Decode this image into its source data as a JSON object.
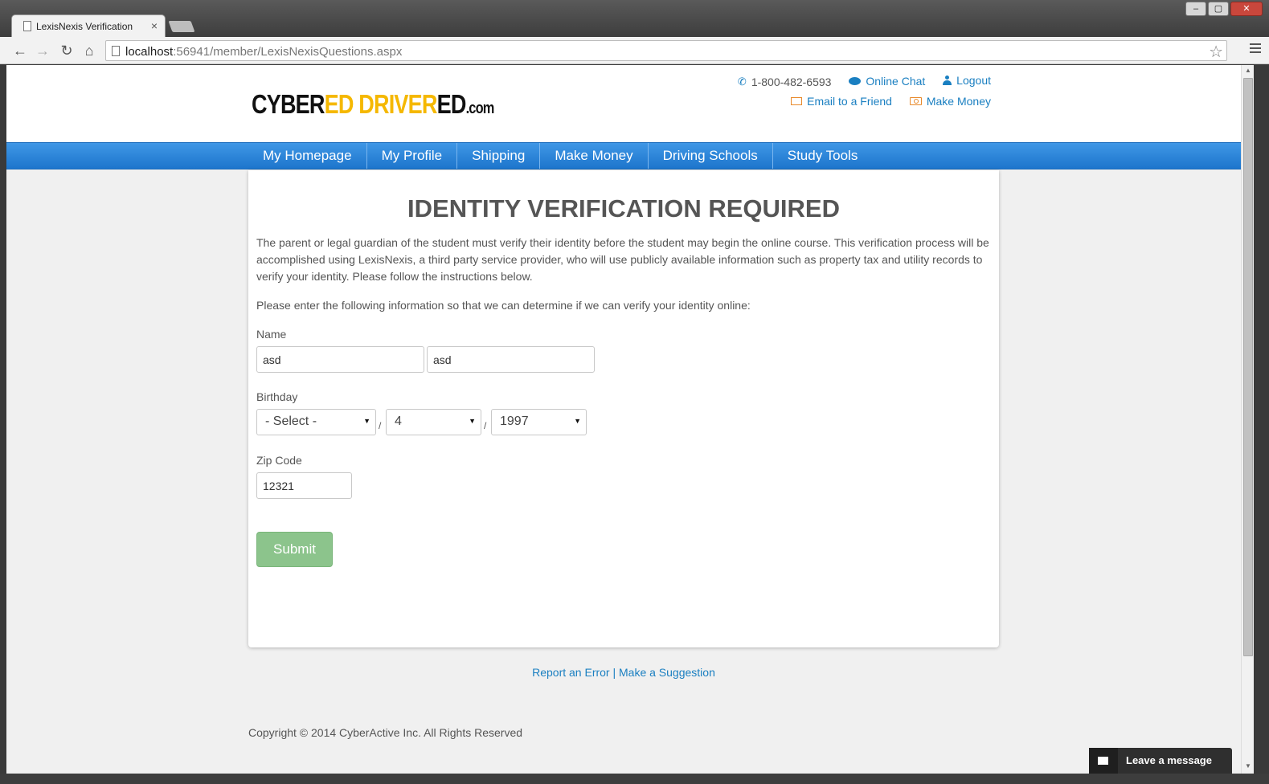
{
  "browser": {
    "tab_title": "LexisNexis Verification",
    "tab_close": "×",
    "url_host": "localhost",
    "url_rest": ":56941/member/LexisNexisQuestions.aspx"
  },
  "header": {
    "logo_parts": [
      "CYBER",
      "ED",
      " DRIVER",
      "ED",
      ".com"
    ],
    "phone": "1-800-482-6593",
    "online_chat": "Online Chat",
    "logout": "Logout",
    "email_friend": "Email to a Friend",
    "make_money": "Make Money"
  },
  "nav": {
    "items": [
      {
        "label": "My Homepage"
      },
      {
        "label": "My Profile"
      },
      {
        "label": "Shipping"
      },
      {
        "label": "Make Money"
      },
      {
        "label": "Driving Schools"
      },
      {
        "label": "Study Tools"
      }
    ]
  },
  "main": {
    "title": "IDENTITY VERIFICATION REQUIRED",
    "intro": "The parent or legal guardian of the student must verify their identity before the student may begin the online course. This verification process will be accomplished using LexisNexis, a third party service provider, who will use publicly available information such as property tax and utility records to verify your identity. Please follow the instructions below.",
    "instruction": "Please enter the following information so that we can determine if we can verify your identity online:",
    "name_label": "Name",
    "first_name": "asd",
    "last_name": "asd",
    "birthday_label": "Birthday",
    "month": "- Select -",
    "day": "4",
    "year": "1997",
    "date_sep": "/",
    "zip_label": "Zip Code",
    "zip": "12321",
    "submit": "Submit"
  },
  "footer": {
    "links": "Report an Error | Make a Suggestion",
    "copyright": "Copyright © 2014 CyberActive Inc. All Rights Reserved"
  },
  "chat_widget": {
    "label": "Leave a message"
  },
  "colors": {
    "accent_blue": "#1a7fc1",
    "nav_blue": "#2a84d8",
    "logo_yellow": "#f5b800",
    "submit_green": "#8cc48c",
    "icon_orange": "#e88a2c"
  }
}
